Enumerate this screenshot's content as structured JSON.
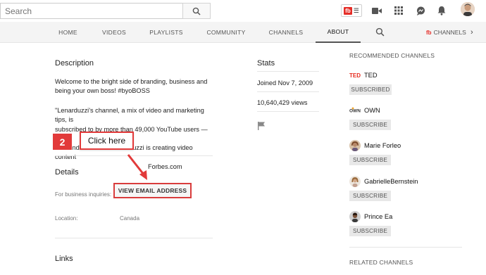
{
  "header": {
    "search_placeholder": "Search",
    "extension_label": "fb"
  },
  "nav": {
    "tabs": [
      {
        "label": "HOME"
      },
      {
        "label": "VIDEOS"
      },
      {
        "label": "PLAYLISTS"
      },
      {
        "label": "COMMUNITY"
      },
      {
        "label": "CHANNELS"
      },
      {
        "label": "ABOUT",
        "active": true
      }
    ],
    "promo_label": "CHANNELS"
  },
  "description": {
    "title": "Description",
    "paragraph1_lines": [
      "Welcome to the bright side of branding, business and",
      "being your own boss! #byoBOSS"
    ],
    "paragraph2_lines": [
      "\"Lenarduzzi's channel, a mix of video and marketing tips, is",
      "subscribed to by more than 49,000 YouTube users — a",
      "clear indication that Lenarduzzi is creating video content",
      "Forbes.com"
    ]
  },
  "details": {
    "title": "Details",
    "business_label": "For business inquiries:",
    "view_email_label": "VIEW EMAIL ADDRESS",
    "location_label": "Location:",
    "location_value": "Canada"
  },
  "links": {
    "title": "Links"
  },
  "annotation": {
    "step_number": "2",
    "callout_text": "Click here",
    "color": "#e23a3a"
  },
  "stats": {
    "title": "Stats",
    "joined": "Joined Nov 7, 2009",
    "views": "10,640,429 views"
  },
  "sidebar": {
    "recommended_heading": "RECOMMENDED CHANNELS",
    "related_heading": "RELATED CHANNELS",
    "channels": [
      {
        "name": "TED",
        "button": "SUBSCRIBED",
        "logo": "ted-logo"
      },
      {
        "name": "OWN",
        "button": "SUBSCRIBE",
        "logo": "own-logo"
      },
      {
        "name": "Marie Forleo",
        "button": "SUBSCRIBE",
        "logo": "avatar"
      },
      {
        "name": "GabrielleBernstein",
        "button": "SUBSCRIBE",
        "logo": "avatar"
      },
      {
        "name": "Prince Ea",
        "button": "SUBSCRIBE",
        "logo": "avatar"
      }
    ]
  },
  "colors": {
    "accent_red": "#e52d27",
    "annotation_red": "#e23a3a",
    "nav_background": "#f4f4f4"
  }
}
